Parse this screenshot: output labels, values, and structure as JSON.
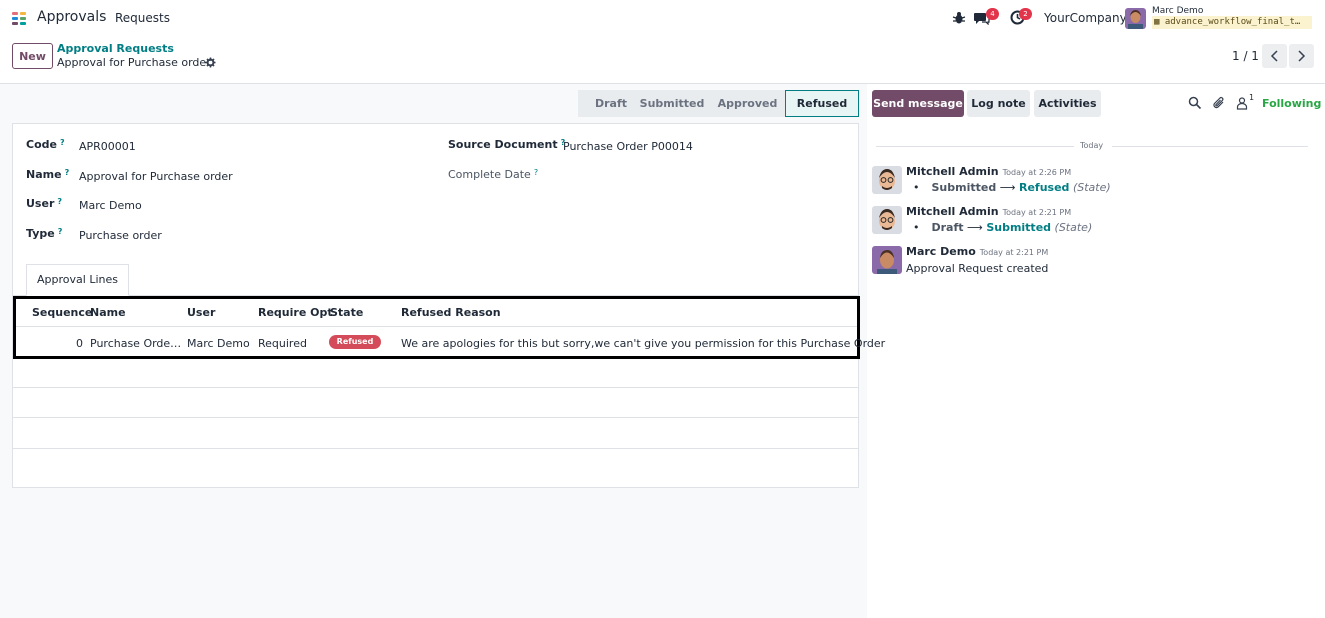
{
  "navbar": {
    "app_name": "Approvals",
    "menu_requests": "Requests",
    "chat_badge": "4",
    "activity_badge": "2",
    "company": "YourCompany",
    "user_name": "Marc Demo",
    "database": "advance_workflow_final_t…"
  },
  "control": {
    "new_label": "New",
    "breadcrumb_parent": "Approval Requests",
    "breadcrumb_current": "Approval for Purchase order",
    "pager": "1 / 1"
  },
  "statusbar": [
    "Draft",
    "Submitted",
    "Approved",
    "Refused"
  ],
  "form": {
    "code_label": "Code",
    "code_value": "APR00001",
    "name_label": "Name",
    "name_value": "Approval for Purchase order",
    "user_label": "User",
    "user_value": "Marc Demo",
    "type_label": "Type",
    "type_value": "Purchase order",
    "source_label": "Source Document",
    "source_value": "Purchase Order P00014",
    "complete_label": "Complete Date",
    "help_mark": "?"
  },
  "tab": {
    "label": "Approval Lines"
  },
  "lines": {
    "headers": [
      "Sequence",
      "Name",
      "User",
      "Require Opt",
      "State",
      "Refused Reason"
    ],
    "row": {
      "sequence": "0",
      "name": "Purchase Orde…",
      "user": "Marc Demo",
      "require": "Required",
      "state": "Refused",
      "reason": "We are apologies for this but sorry,we can't give you permission for this Purchase Order"
    }
  },
  "chatter": {
    "send_message": "Send message",
    "log_note": "Log note",
    "activities": "Activities",
    "followers_count": "1",
    "following": "Following",
    "day_label": "Today",
    "messages": [
      {
        "author": "Mitchell Admin",
        "time": "Today at 2:26 PM",
        "old": "Submitted",
        "arrow": "⟶",
        "new": "Refused",
        "field": "(State)"
      },
      {
        "author": "Mitchell Admin",
        "time": "Today at 2:21 PM",
        "old": "Draft",
        "arrow": "⟶",
        "new": "Submitted",
        "field": "(State)"
      },
      {
        "author": "Marc Demo",
        "time": "Today at 2:21 PM",
        "body": "Approval Request created"
      }
    ]
  },
  "colors": {
    "brand": "#714b67",
    "link": "#017e84",
    "danger": "#d44c59",
    "success": "#28a745"
  }
}
